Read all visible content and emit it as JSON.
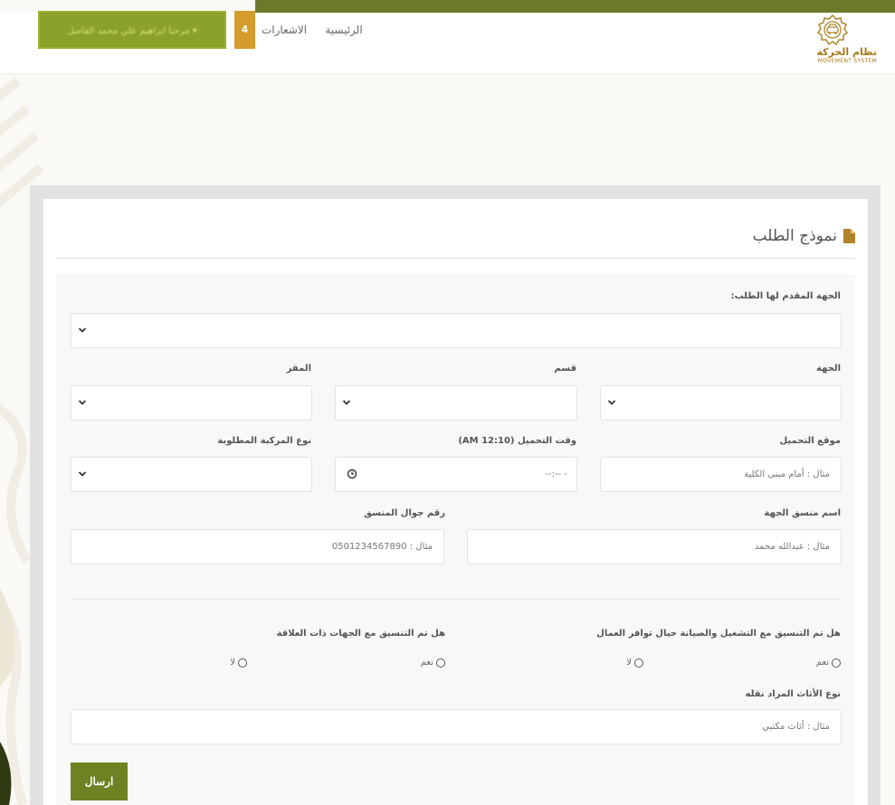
{
  "header": {
    "logo_ar": "نظام الحركة",
    "logo_en": "MOVEMENT SYSTEM",
    "nav_home": "الرئيسية",
    "nav_notifications": "الاشعارات",
    "notifications_count": "4",
    "user_greeting": "مرحبا ابراهيم علي محمد الفاضل ▾"
  },
  "card": {
    "title": "نموذج الطلب"
  },
  "form": {
    "target_entity": {
      "label": "الجهة المقدم لها الطلب:",
      "value": ""
    },
    "entity": {
      "label": "الجهة",
      "value": ""
    },
    "department": {
      "label": "قسم",
      "value": ""
    },
    "headquarters": {
      "label": "المقر",
      "value": ""
    },
    "pickup_location": {
      "label": "موقع التحميل",
      "placeholder": "مثال : أمام مبنى الكلية"
    },
    "pickup_time": {
      "label": "وقت التحميل (AM 12:10)",
      "placeholder": "--:-- -"
    },
    "vehicle_type": {
      "label": "نوع المركبة المطلوبة",
      "value": ""
    },
    "coordinator_name": {
      "label": "اسم منسق الجهة",
      "placeholder": "مثال : عبدالله محمد"
    },
    "coordinator_phone": {
      "label": "رقم جوال المنسق",
      "placeholder": "مثال : 0501234567890"
    },
    "q_maintenance": {
      "label": "هل تم التنسيق مع التشغيل والصيانة حيال توافر العمال",
      "yes": "نعم",
      "no": "لا"
    },
    "q_related": {
      "label": "هل تم التنسيق مع الجهات ذات العلاقة",
      "yes": "نعم",
      "no": "لا"
    },
    "furniture_type": {
      "label": "نوع الأثاث المراد نقله",
      "placeholder": "مثال : أثاث مكتبي"
    },
    "submit_label": "ارسال"
  },
  "colors": {
    "brand_green": "#6f8223",
    "accent_gold": "#d39c2c",
    "header_strip": "#6b7a2a"
  }
}
